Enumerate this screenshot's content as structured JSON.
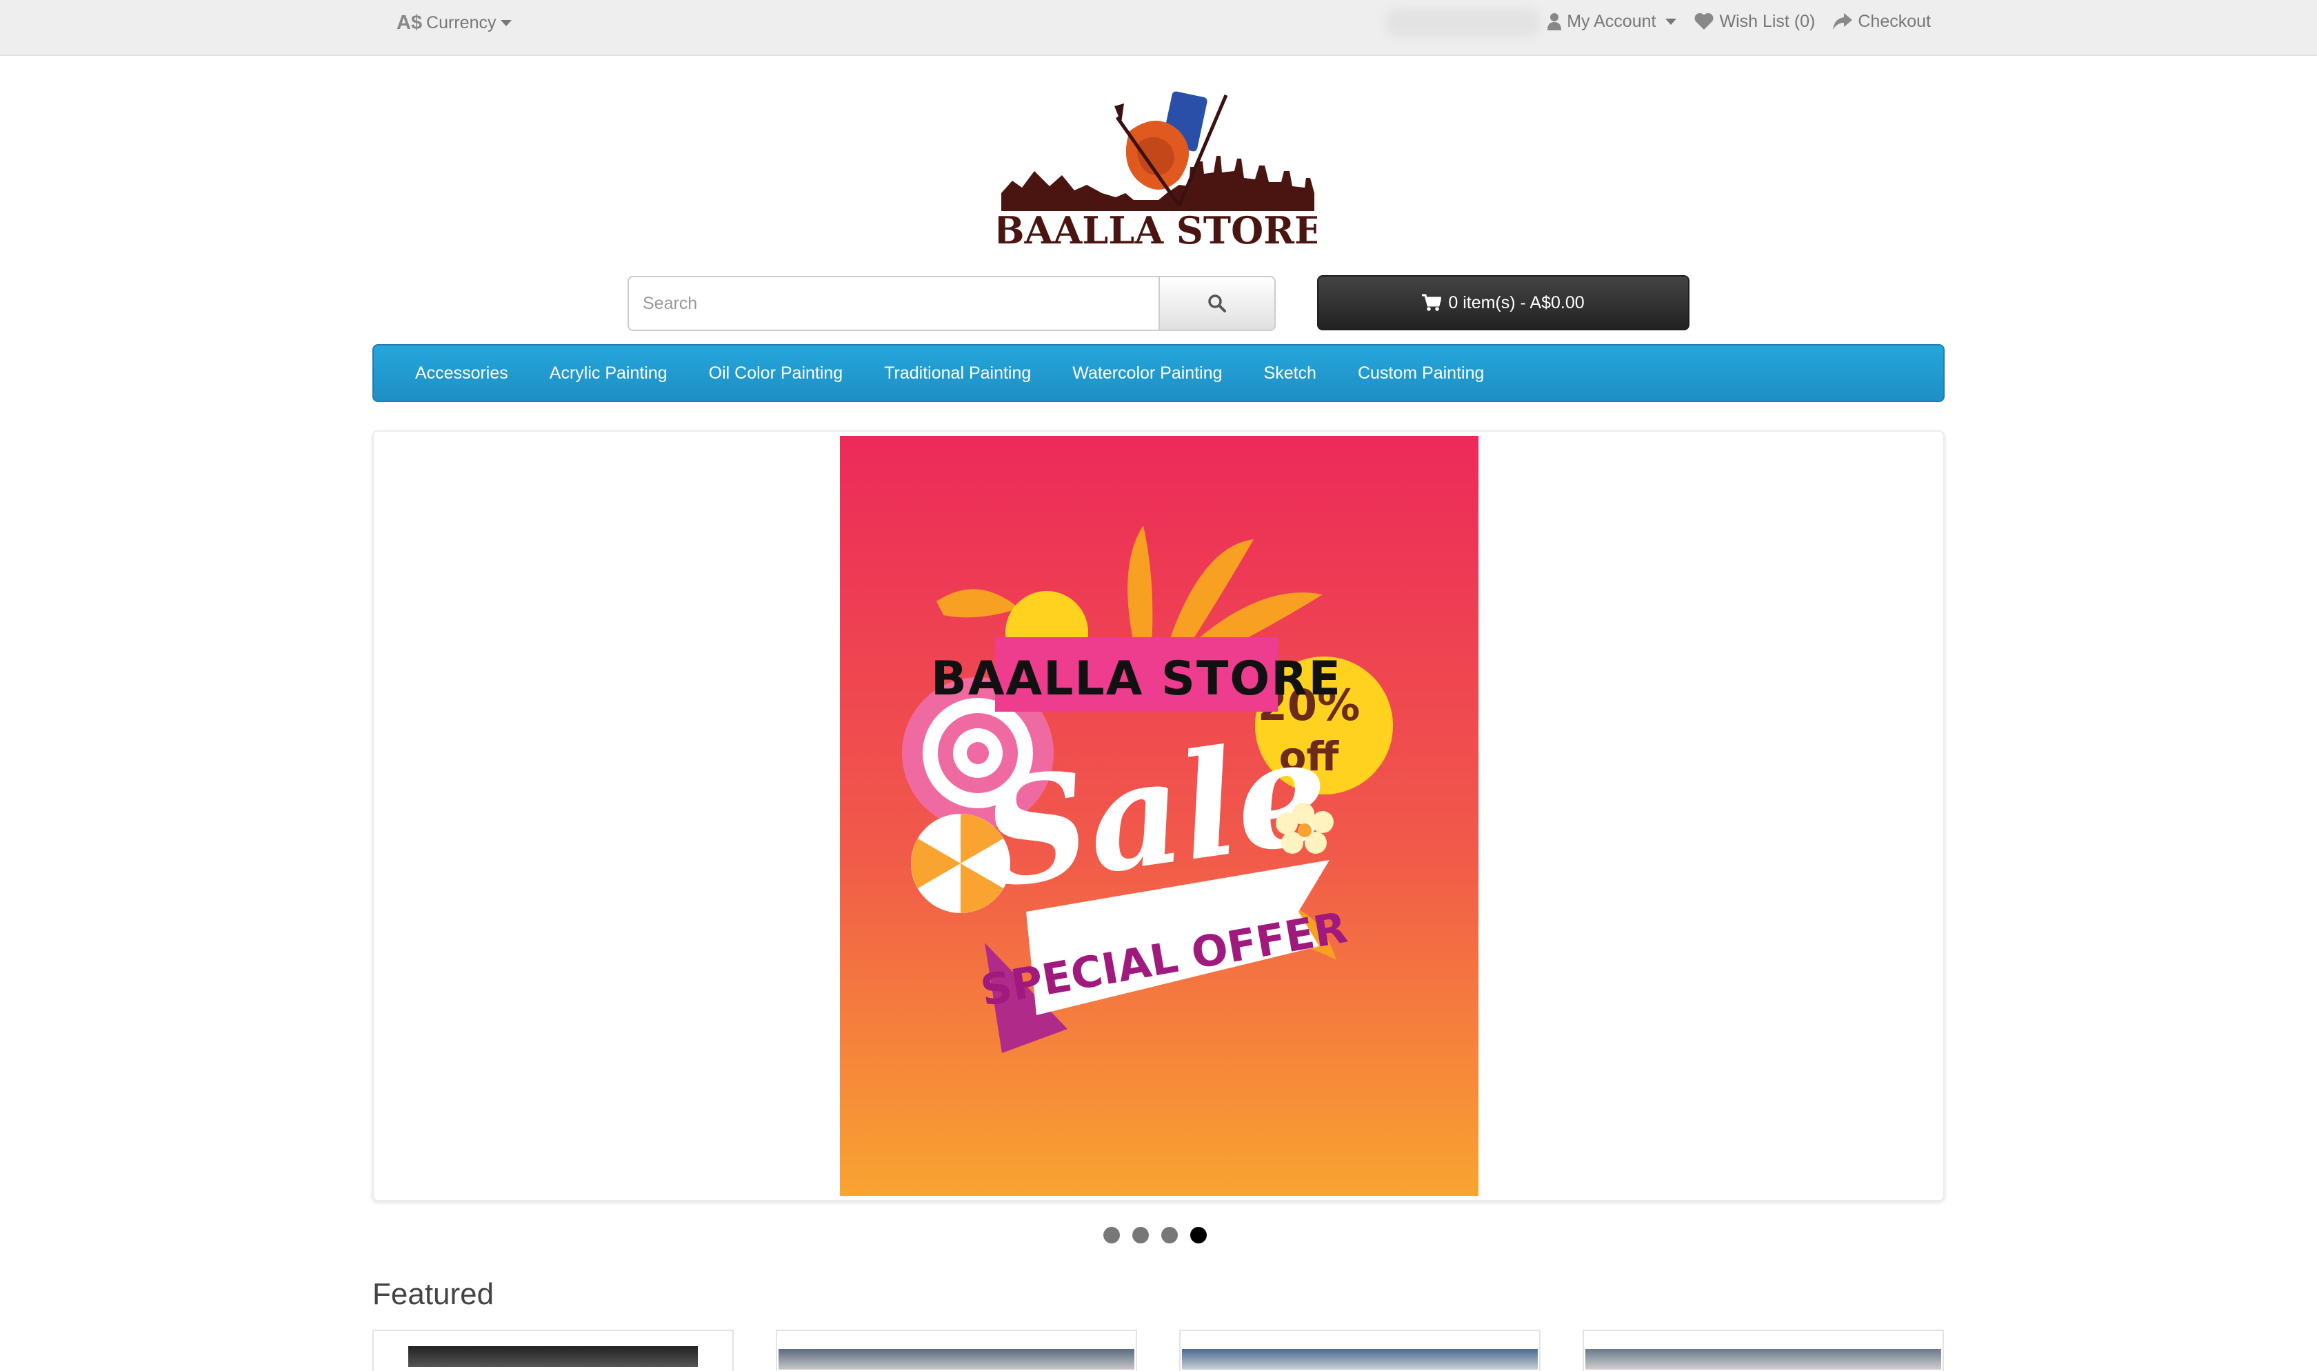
{
  "topbar": {
    "currency_symbol": "A$",
    "currency_label": "Currency",
    "account_label": "My Account",
    "wishlist_label": "Wish List (0)",
    "checkout_label": "Checkout"
  },
  "header": {
    "logo_text": "BAALLA STORE",
    "search": {
      "placeholder": "Search",
      "value": ""
    },
    "cart_label": "0 item(s) - A$0.00"
  },
  "menu": {
    "items": [
      "Accessories",
      "Acrylic Painting",
      "Oil Color Painting",
      "Traditional Painting",
      "Watercolor Painting",
      "Sketch",
      "Custom Painting"
    ]
  },
  "slideshow": {
    "banner": {
      "store_name": "BAALLA STORE",
      "sale_text": "Sale",
      "discount_percent": "20%",
      "discount_off": "off",
      "offer_text": "SPECIAL OFFER"
    },
    "slide_count": 4,
    "active_slide": 4
  },
  "featured": {
    "title": "Featured"
  },
  "colors": {
    "nav_blue": "#229ac8",
    "cart_dark": "#303030",
    "banner_pink": "#ec2a5a",
    "banner_orange": "#f9a431"
  }
}
